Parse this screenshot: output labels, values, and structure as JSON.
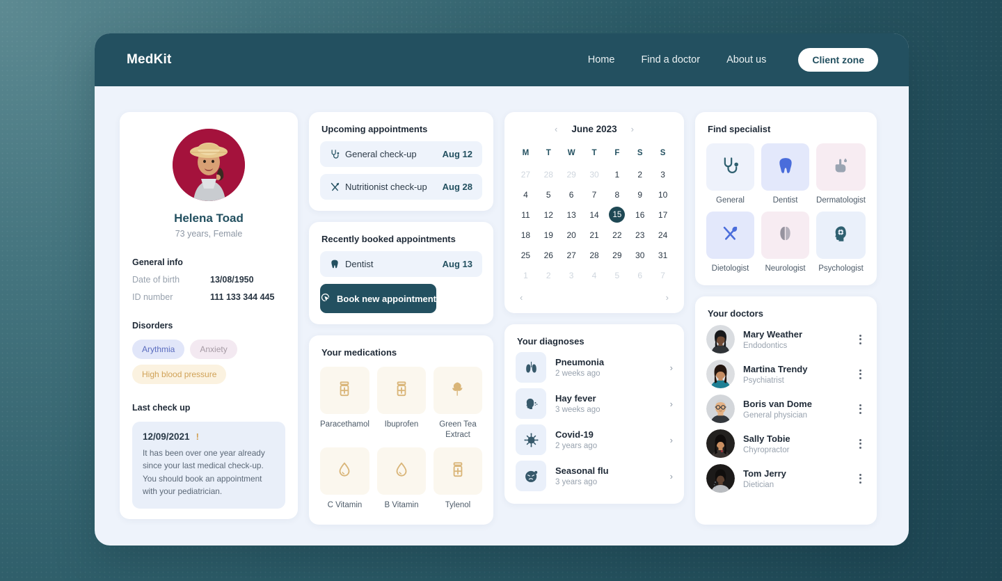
{
  "header": {
    "brand": "MedKit",
    "nav": [
      {
        "label": "Home",
        "name": "nav-home"
      },
      {
        "label": "Find a doctor",
        "name": "nav-find-a-doctor"
      },
      {
        "label": "About us",
        "name": "nav-about-us"
      }
    ],
    "client_zone_label": "Client zone"
  },
  "profile": {
    "name": "Helena Toad",
    "subtitle": "73 years, Female",
    "general_info_title": "General info",
    "fields": [
      {
        "label": "Date of birth",
        "value": "13/08/1950"
      },
      {
        "label": "ID number",
        "value": "111 133 344 445"
      }
    ],
    "disorders_title": "Disorders",
    "disorders": [
      {
        "label": "Arythmia",
        "style": "lav"
      },
      {
        "label": "Anxiety",
        "style": "pink"
      },
      {
        "label": "High blood pressure",
        "style": "gold"
      }
    ],
    "last_checkup_title": "Last check up",
    "last_checkup": {
      "date": "12/09/2021",
      "warning_mark": "!",
      "message": "It has been over one year already since your last medical check-up. You should book an appointment with your pediatrician."
    }
  },
  "upcoming": {
    "title": "Upcoming appointments",
    "items": [
      {
        "label": "General check-up",
        "date": "Aug 12",
        "icon": "stethoscope-icon"
      },
      {
        "label": "Nutritionist check-up",
        "date": "Aug 28",
        "icon": "cutlery-icon"
      }
    ]
  },
  "recently_booked": {
    "title": "Recently booked appointments",
    "items": [
      {
        "label": "Dentist",
        "date": "Aug 13",
        "icon": "tooth-icon"
      }
    ],
    "book_button_label": "Book new appointment"
  },
  "medications": {
    "title": "Your medications",
    "items": [
      {
        "label": "Paracethamol",
        "icon": "pill-bottle-icon"
      },
      {
        "label": "Ibuprofen",
        "icon": "pill-bottle-icon"
      },
      {
        "label": "Green Tea Extract",
        "icon": "leaf-icon"
      },
      {
        "label": "C Vitamin",
        "icon": "droplet-icon"
      },
      {
        "label": "B Vitamin",
        "icon": "droplet-icon"
      },
      {
        "label": "Tylenol",
        "icon": "pill-bottle-icon"
      }
    ]
  },
  "calendar": {
    "title": "June 2023",
    "prev_label": "‹",
    "next_label": "›",
    "dow": [
      "M",
      "T",
      "W",
      "T",
      "F",
      "S",
      "S"
    ],
    "weeks": [
      [
        {
          "d": "27",
          "muted": true
        },
        {
          "d": "28",
          "muted": true
        },
        {
          "d": "29",
          "muted": true
        },
        {
          "d": "30",
          "muted": true
        },
        {
          "d": "1"
        },
        {
          "d": "2"
        },
        {
          "d": "3"
        }
      ],
      [
        {
          "d": "4"
        },
        {
          "d": "5"
        },
        {
          "d": "6"
        },
        {
          "d": "7"
        },
        {
          "d": "8"
        },
        {
          "d": "9"
        },
        {
          "d": "10"
        }
      ],
      [
        {
          "d": "11"
        },
        {
          "d": "12"
        },
        {
          "d": "13"
        },
        {
          "d": "14"
        },
        {
          "d": "15",
          "today": true
        },
        {
          "d": "16"
        },
        {
          "d": "17"
        }
      ],
      [
        {
          "d": "18"
        },
        {
          "d": "19"
        },
        {
          "d": "20"
        },
        {
          "d": "21"
        },
        {
          "d": "22"
        },
        {
          "d": "23"
        },
        {
          "d": "24"
        }
      ],
      [
        {
          "d": "25"
        },
        {
          "d": "26"
        },
        {
          "d": "27"
        },
        {
          "d": "28"
        },
        {
          "d": "29"
        },
        {
          "d": "30"
        },
        {
          "d": "31"
        }
      ],
      [
        {
          "d": "1",
          "muted": true
        },
        {
          "d": "2",
          "muted": true
        },
        {
          "d": "3",
          "muted": true
        },
        {
          "d": "4",
          "muted": true
        },
        {
          "d": "5",
          "muted": true
        },
        {
          "d": "6",
          "muted": true
        },
        {
          "d": "7",
          "muted": true
        }
      ]
    ],
    "foot_prev_label": "‹",
    "foot_next_label": "›"
  },
  "diagnoses": {
    "title": "Your diagnoses",
    "items": [
      {
        "name": "Pneumonia",
        "when": "2 weeks ago",
        "icon": "lungs-icon"
      },
      {
        "name": "Hay fever",
        "when": "3 weeks ago",
        "icon": "sneeze-icon"
      },
      {
        "name": "Covid-19",
        "when": "2 years ago",
        "icon": "virus-icon"
      },
      {
        "name": "Seasonal flu",
        "when": "3 years ago",
        "icon": "sick-face-icon"
      }
    ],
    "chevron": "›"
  },
  "specialists": {
    "title": "Find specialist",
    "items": [
      {
        "label": "General",
        "icon": "stethoscope-icon",
        "tile": "#eef2fb",
        "color": "#2f6070"
      },
      {
        "label": "Dentist",
        "icon": "tooth-icon",
        "tile": "#e3e8fb",
        "color": "#4a6ddb"
      },
      {
        "label": "Dermatologist",
        "icon": "hand-lotion-icon",
        "tile": "#f7ecf2",
        "color": "#9aa4b2"
      },
      {
        "label": "Dietologist",
        "icon": "cutlery-icon",
        "tile": "#e3e8fb",
        "color": "#4a6ddb"
      },
      {
        "label": "Neurologist",
        "icon": "brain-icon",
        "tile": "#f7ecf2",
        "color": "#96939f"
      },
      {
        "label": "Psychologist",
        "icon": "head-gear-icon",
        "tile": "#eaf0fa",
        "color": "#2f6070"
      }
    ]
  },
  "doctors": {
    "title": "Your doctors",
    "items": [
      {
        "name": "Mary Weather",
        "specialty": "Endodontics"
      },
      {
        "name": "Martina Trendy",
        "specialty": "Psychiatrist"
      },
      {
        "name": "Boris van Dome",
        "specialty": "General physician"
      },
      {
        "name": "Sally Tobie",
        "specialty": "Chyropractor"
      },
      {
        "name": "Tom Jerry",
        "specialty": "Dietician"
      }
    ]
  }
}
